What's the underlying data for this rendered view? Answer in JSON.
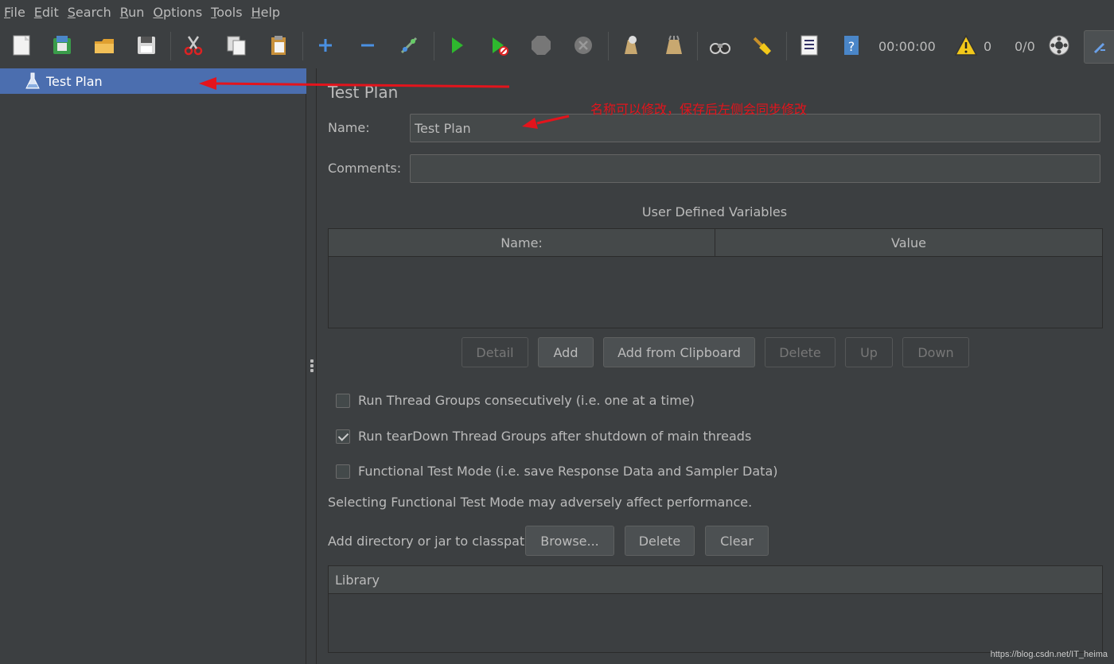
{
  "menu": [
    "File",
    "Edit",
    "Search",
    "Run",
    "Options",
    "Tools",
    "Help"
  ],
  "menu_mnemonics": [
    "F",
    "E",
    "S",
    "R",
    "O",
    "T",
    "H"
  ],
  "menu_rest": [
    "ile",
    "dit",
    "earch",
    "un",
    "ptions",
    "ools",
    "elp"
  ],
  "toolbar": {
    "timer": "00:00:00",
    "warnings": "0",
    "threads": "0/0"
  },
  "tree": {
    "root_label": "Test Plan"
  },
  "panel": {
    "title": "Test Plan",
    "name_label": "Name:",
    "name_value": "Test Plan",
    "comments_label": "Comments:",
    "comments_value": "",
    "udv_title": "User Defined Variables",
    "udv_columns": [
      "Name:",
      "Value"
    ],
    "udv_buttons": [
      "Detail",
      "Add",
      "Add from Clipboard",
      "Delete",
      "Up",
      "Down"
    ],
    "options": [
      {
        "label": "Run Thread Groups consecutively (i.e. one at a time)",
        "checked": false
      },
      {
        "label": "Run tearDown Thread Groups after shutdown of main threads",
        "checked": true
      },
      {
        "label": "Functional Test Mode (i.e. save Response Data and Sampler Data)",
        "checked": false
      }
    ],
    "functional_note": "Selecting Functional Test Mode may adversely affect performance.",
    "classpath_label": "Add directory or jar to classpath",
    "classpath_buttons": [
      "Browse...",
      "Delete",
      "Clear"
    ],
    "library_header": "Library"
  },
  "annotation": {
    "text": "名称可以修改，保存后左侧会同步修改",
    "color": "#e3141c"
  },
  "watermark": "https://blog.csdn.net/IT_heima",
  "colors": {
    "background": "#3c3f41",
    "selection": "#4b6eaf",
    "text": "#bbbbbb"
  }
}
